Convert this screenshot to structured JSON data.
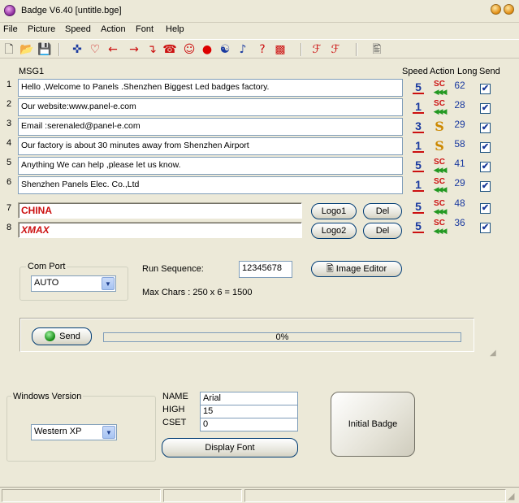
{
  "window": {
    "title": "Badge V6.40 [untitle.bge]"
  },
  "menu": [
    {
      "label": "File"
    },
    {
      "label": "Picture"
    },
    {
      "label": "Speed"
    },
    {
      "label": "Action"
    },
    {
      "label": "Font"
    },
    {
      "label": "Help"
    }
  ],
  "toolbar": [
    {
      "icon": "new-file-icon",
      "glyph": "🗋",
      "color": "#333"
    },
    {
      "icon": "open-folder-icon",
      "glyph": "📂",
      "color": "#c89a20"
    },
    {
      "icon": "save-icon",
      "glyph": "💾",
      "color": "#333"
    },
    {
      "icon": "crosshair-icon",
      "glyph": "✜",
      "color": "#1a3aa0"
    },
    {
      "icon": "heart-icon",
      "glyph": "♡",
      "color": "#cc1010"
    },
    {
      "icon": "arrow-left-icon",
      "glyph": "←",
      "color": "#cc1010"
    },
    {
      "icon": "arrow-right-icon",
      "glyph": "→",
      "color": "#cc1010"
    },
    {
      "icon": "turn-arrow-icon",
      "glyph": "↴",
      "color": "#cc1010"
    },
    {
      "icon": "telephone-icon",
      "glyph": "☎",
      "color": "#cc1010"
    },
    {
      "icon": "smiley-icon",
      "glyph": "☺",
      "color": "#cc1010"
    },
    {
      "icon": "red-dot-icon",
      "glyph": "●",
      "color": "#dd0000"
    },
    {
      "icon": "yin-yang-icon",
      "glyph": "☯",
      "color": "#1a3aa0"
    },
    {
      "icon": "music-note-icon",
      "glyph": "♪",
      "color": "#1a3aa0"
    },
    {
      "icon": "question-icon",
      "glyph": "?",
      "color": "#cc1010"
    },
    {
      "icon": "grid-pattern-icon",
      "glyph": "▩",
      "color": "#cc1010"
    },
    {
      "icon": "font-f-icon",
      "glyph": "ℱ",
      "color": "#cc1010"
    },
    {
      "icon": "font-f-outline-icon",
      "glyph": "ℱ",
      "color": "#cc1010"
    },
    {
      "icon": "image-editor-icon",
      "glyph": "🖺",
      "color": "#555"
    }
  ],
  "messages": {
    "group_label": "MSG1",
    "headers": {
      "speed": "Speed",
      "action": "Action",
      "long": "Long",
      "send": "Send"
    },
    "rows": [
      {
        "num": "1",
        "text": "Hello ,Welcome to Panels .Shenzhen Biggest Led badges factory.",
        "speed": "5",
        "speed_color": "#1a3aa0",
        "action": "SC",
        "long": "62",
        "send": "✔"
      },
      {
        "num": "2",
        "text": "Our website:www.panel-e.com",
        "speed": "1",
        "speed_color": "#1a3aa0",
        "action": "SC",
        "long": "28",
        "send": "✔"
      },
      {
        "num": "3",
        "text": "Email :serenaled@panel-e.com",
        "speed": "3",
        "speed_color": "#1a3aa0",
        "action": "S",
        "long": "29",
        "send": "✔"
      },
      {
        "num": "4",
        "text": "Our factory is about 30 minutes away from Shenzhen Airport",
        "speed": "1",
        "speed_color": "#1a3aa0",
        "action": "S",
        "long": "58",
        "send": "✔"
      },
      {
        "num": "5",
        "text": "Anything We can help ,please let us know.",
        "speed": "5",
        "speed_color": "#1a3aa0",
        "action": "SC",
        "long": "41",
        "send": "✔"
      },
      {
        "num": "6",
        "text": "Shenzhen Panels Elec. Co.,Ltd",
        "speed": "1",
        "speed_color": "#1a3aa0",
        "action": "SC",
        "long": "29",
        "send": "✔"
      }
    ],
    "logo_rows": [
      {
        "num": "7",
        "text": "CHINA",
        "button": "Logo1",
        "del": "Del",
        "speed": "5",
        "action": "SC",
        "long": "48",
        "send": "✔"
      },
      {
        "num": "8",
        "text": "XMAX",
        "button": "Logo2",
        "del": "Del",
        "speed": "5",
        "action": "SC",
        "long": "36",
        "send": "✔"
      }
    ],
    "action_arrows": "◀◀◀"
  },
  "com_port": {
    "label": "Com Port",
    "value": "AUTO"
  },
  "run_sequence": {
    "label": "Run Sequence:",
    "value": "12345678"
  },
  "image_editor": {
    "label": "Image Editor"
  },
  "max_chars": "Max Chars : 250 x 6 = 1500",
  "send": {
    "label": "Send",
    "progress_text": "0%",
    "progress": 0
  },
  "windows_version": {
    "label": "Windows Version",
    "value": "Western XP"
  },
  "font": {
    "name_label": "NAME",
    "name_value": "Arial",
    "high_label": "HIGH",
    "high_value": "15",
    "cset_label": "CSET",
    "cset_value": "0",
    "display_button": "Display Font"
  },
  "initial_badge": {
    "label": "Initial Badge"
  },
  "colors": {
    "accent_red": "#cc1010",
    "accent_blue": "#1a3aa0",
    "face": "#ece9d8"
  }
}
